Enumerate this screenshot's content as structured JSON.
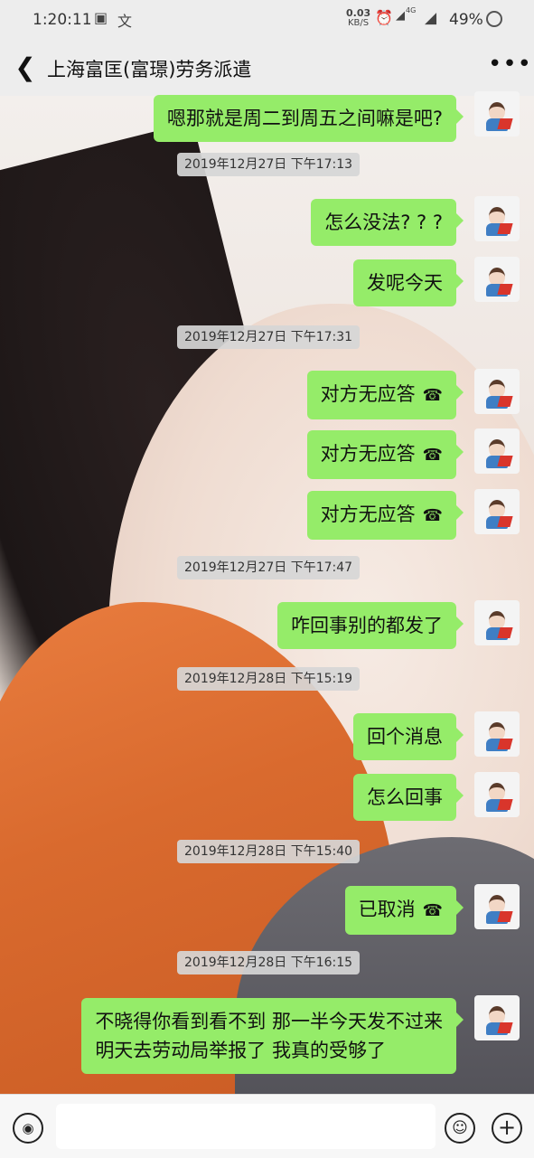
{
  "status_bar": {
    "time": "1:20:11",
    "speed_value": "0.03",
    "speed_unit": "KB/S",
    "network": "4G",
    "battery": "49%"
  },
  "chat": {
    "back_icon": "chevron-left-icon",
    "title": "上海富匡(富璟)劳务派遣",
    "more_icon": "more-dots-icon"
  },
  "messages": [
    {
      "type": "text",
      "text": "嗯那就是周二到周五之间嘛是吧?"
    },
    {
      "type": "timestamp",
      "text": "2019年12月27日 下午17:13"
    },
    {
      "type": "text",
      "text": "怎么没法? ? ?"
    },
    {
      "type": "text",
      "text": "发呢今天"
    },
    {
      "type": "timestamp",
      "text": "2019年12月27日 下午17:31"
    },
    {
      "type": "call",
      "text": "对方无应答"
    },
    {
      "type": "call",
      "text": "对方无应答"
    },
    {
      "type": "call",
      "text": "对方无应答"
    },
    {
      "type": "timestamp",
      "text": "2019年12月27日 下午17:47"
    },
    {
      "type": "text",
      "text": "咋回事别的都发了"
    },
    {
      "type": "timestamp",
      "text": "2019年12月28日 下午15:19"
    },
    {
      "type": "text",
      "text": "回个消息"
    },
    {
      "type": "text",
      "text": "怎么回事"
    },
    {
      "type": "timestamp",
      "text": "2019年12月28日 下午15:40"
    },
    {
      "type": "call",
      "text": "已取消"
    },
    {
      "type": "timestamp",
      "text": "2019年12月28日 下午16:15"
    },
    {
      "type": "text",
      "text": "不晓得你看到看不到 那一半今天发不过来",
      "text2": "明天去劳动局举报了  我真的受够了"
    }
  ],
  "input_bar": {
    "voice_icon": "voice-icon",
    "emoji_icon": "emoji-icon",
    "plus_icon": "plus-icon",
    "placeholder": ""
  },
  "colors": {
    "bubble_green": "#95ec69",
    "bar_gray": "#ededed",
    "timestamp_bg": "#d6d6d6"
  }
}
